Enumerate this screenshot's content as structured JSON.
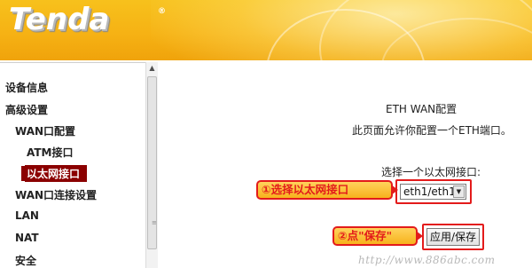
{
  "header": {
    "brand": "Tenda",
    "registered_mark": "®"
  },
  "sidebar": {
    "items": [
      {
        "label": "设备信息",
        "level": 1
      },
      {
        "label": "高级设置",
        "level": 1
      },
      {
        "label": "WAN口配置",
        "level": 2
      },
      {
        "label": "ATM接口",
        "level": 3
      },
      {
        "label": "以太网接口",
        "level": 3,
        "active": true
      },
      {
        "label": "WAN口连接设置",
        "level": 2
      },
      {
        "label": "LAN",
        "level": 2
      },
      {
        "label": "NAT",
        "level": 2
      },
      {
        "label": "安全",
        "level": 2
      }
    ]
  },
  "scrollbar": {
    "up_arrow": "▲",
    "grip": "≡"
  },
  "main": {
    "title": "ETH WAN配置",
    "description": "此页面允许你配置一个ETH端口。",
    "field_label": "选择一个以太网接口:",
    "select_value": "eth1/eth1",
    "select_arrow": "▼",
    "save_label": "应用/保存"
  },
  "annotations": {
    "step1": "①选择以太网接口",
    "step2": "②点\"保存\""
  },
  "watermark": "http://www.886abc.com",
  "colors": {
    "header": "#f6b214",
    "active_nav": "#8b0000",
    "annotation_border": "#e31b1b"
  }
}
